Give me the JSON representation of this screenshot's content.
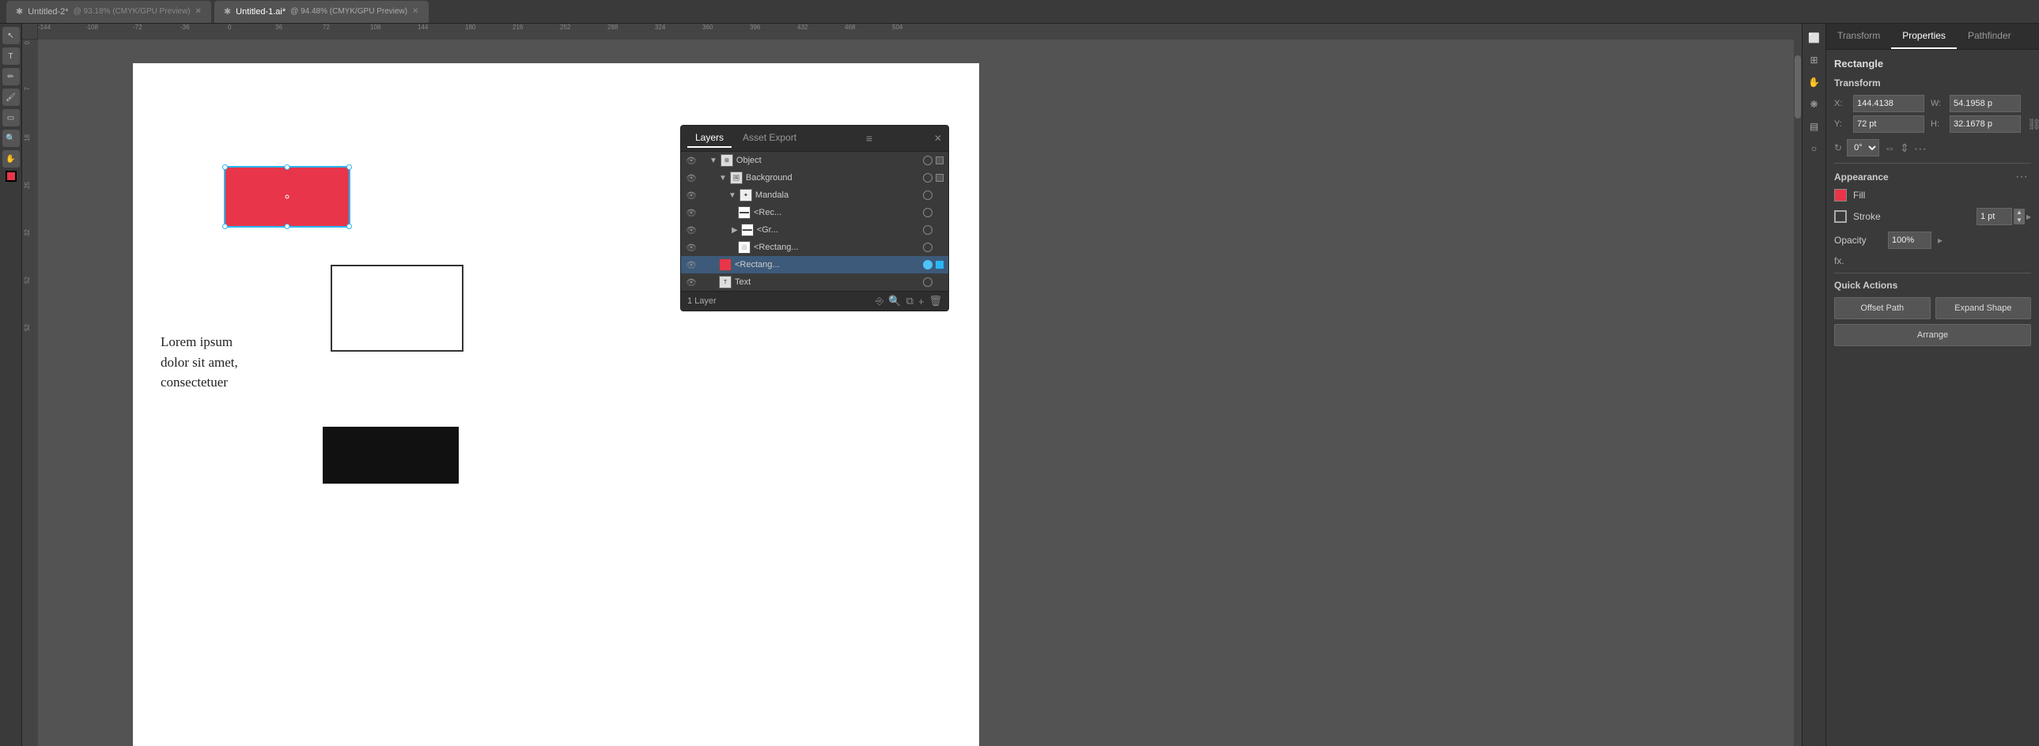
{
  "tabs": [
    {
      "label": "Untitled-2*",
      "subtitle": "@ 93.18% (CMYK/GPU Preview)",
      "active": false,
      "dirty": true
    },
    {
      "label": "Untitled-1.ai*",
      "subtitle": "@ 94.48% (CMYK/GPU Preview)",
      "active": true,
      "dirty": true
    }
  ],
  "panel": {
    "tabs": [
      "Transform",
      "Properties",
      "Pathfinder"
    ],
    "active_tab": "Properties",
    "rect_label": "Rectangle",
    "transform_label": "Transform",
    "x_label": "X:",
    "x_value": "144.4138",
    "y_label": "Y:",
    "y_value": "72 pt",
    "w_label": "W:",
    "w_value": "54.1958 p",
    "h_label": "H:",
    "h_value": "32.1678 p",
    "rotate_label": "0°",
    "appearance_label": "Appearance",
    "fill_label": "Fill",
    "stroke_label": "Stroke",
    "stroke_value": "1 pt",
    "opacity_label": "Opacity",
    "opacity_value": "100%",
    "fx_label": "fx.",
    "quick_actions_label": "Quick Actions",
    "offset_path_label": "Offset Path",
    "expand_shape_label": "Expand Shape",
    "arrange_label": "Arrange"
  },
  "layers": {
    "title": "Layers",
    "asset_export_label": "Asset Export",
    "items": [
      {
        "name": "Object",
        "indent": 0,
        "visible": true,
        "selected": false,
        "type": "group"
      },
      {
        "name": "Background",
        "indent": 1,
        "visible": true,
        "selected": false,
        "type": "group"
      },
      {
        "name": "Mandala",
        "indent": 2,
        "visible": true,
        "selected": false,
        "type": "group"
      },
      {
        "name": "<Rec...",
        "indent": 3,
        "visible": true,
        "selected": false,
        "type": "item"
      },
      {
        "name": "<Gr...",
        "indent": 3,
        "visible": true,
        "selected": false,
        "type": "item"
      },
      {
        "name": "<Rectang...",
        "indent": 3,
        "visible": true,
        "selected": false,
        "type": "item"
      },
      {
        "name": "<Rectang...",
        "indent": 2,
        "visible": true,
        "selected": true,
        "type": "item"
      },
      {
        "name": "Text",
        "indent": 1,
        "visible": true,
        "selected": false,
        "type": "item"
      }
    ],
    "footer_label": "1 Layer"
  },
  "canvas": {
    "lorem_text": "Lorem ipsum\ndolor sit amet,\nconsectetuer",
    "ruler_marks_h": [
      "-144",
      "-108",
      "-72",
      "-36",
      "0",
      "36",
      "72",
      "108",
      "144",
      "180",
      "216",
      "252",
      "288",
      "324",
      "360",
      "396",
      "432",
      "468",
      "504"
    ],
    "ruler_marks_v": [
      "0",
      "7",
      "",
      "18",
      "",
      "2",
      "5",
      "3",
      "2",
      "",
      "5",
      "2"
    ]
  }
}
